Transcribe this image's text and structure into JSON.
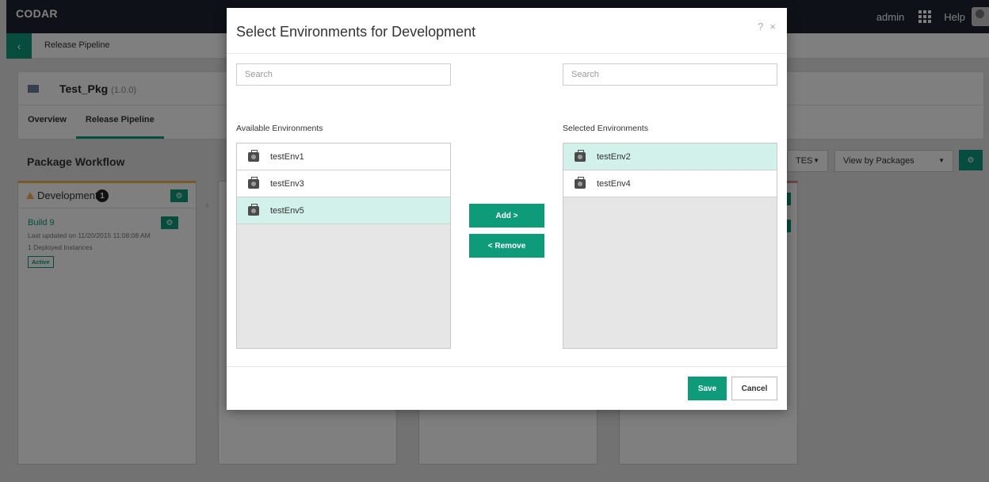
{
  "app": {
    "brand": "CODAR",
    "user": "admin",
    "help": "Help"
  },
  "breadcrumb": {
    "back_icon": "chevron-left-icon",
    "label": "Release Pipeline"
  },
  "package": {
    "name": "Test_Pkg",
    "version": "(1.0.0)",
    "tabs": [
      {
        "label": "Overview"
      },
      {
        "label": "Release Pipeline",
        "active": true
      }
    ]
  },
  "workflow": {
    "title": "Package Workflow",
    "filter_partial": "TES",
    "view_select": "View by Packages"
  },
  "stage": {
    "name": "Development",
    "count": "1",
    "build": {
      "name": "Build 9",
      "updated": "Last updated on 11/20/2015 11:08:08 AM",
      "instances": "1 Deployed Instances",
      "status": "Active"
    }
  },
  "dialog": {
    "title": "Select Environments for Development",
    "help_icon": "?",
    "close_icon": "×",
    "left": {
      "search_placeholder": "Search",
      "label": "Available Environments",
      "items": [
        {
          "name": "testEnv1",
          "selected": false
        },
        {
          "name": "testEnv3",
          "selected": false
        },
        {
          "name": "testEnv5",
          "selected": true
        }
      ]
    },
    "right": {
      "search_placeholder": "Search",
      "label": "Selected Environments",
      "items": [
        {
          "name": "testEnv2",
          "selected": true
        },
        {
          "name": "testEnv4",
          "selected": false
        }
      ]
    },
    "add_label": "Add >",
    "remove_label": "< Remove",
    "save_label": "Save",
    "cancel_label": "Cancel"
  },
  "colors": {
    "accent": "#0d9b7a",
    "selected_row": "#d2f1ea",
    "topbar": "#1d2430"
  }
}
